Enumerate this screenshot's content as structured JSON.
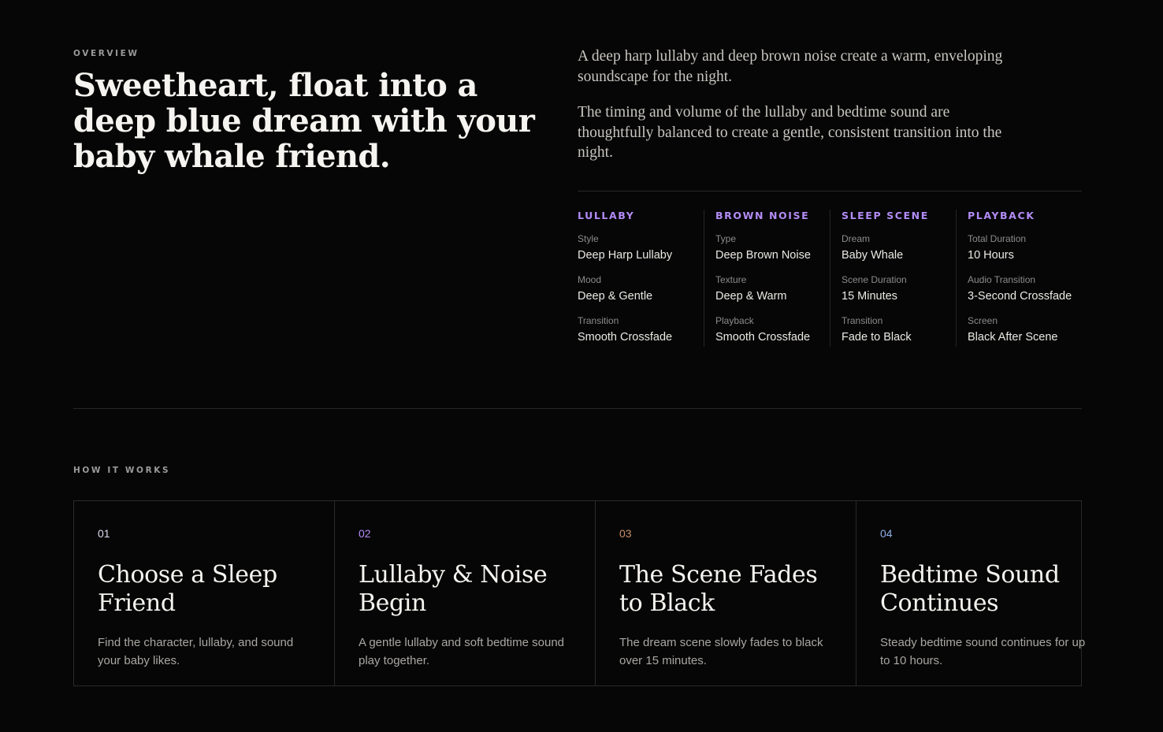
{
  "overview": {
    "eyebrow": "OVERVIEW",
    "title": "Sweetheart, float into a deep blue dream with your baby whale friend.",
    "paragraphs": [
      "A deep harp lullaby and deep brown noise create a warm, enveloping soundscape for the night.",
      "The timing and volume of the lullaby and bedtime sound are thoughtfully balanced to create a gentle, consistent transition into the night."
    ]
  },
  "specs": [
    {
      "heading": "LULLABY",
      "items": [
        {
          "key": "Style",
          "value": "Deep Harp Lullaby"
        },
        {
          "key": "Mood",
          "value": "Deep & Gentle"
        },
        {
          "key": "Transition",
          "value": "Smooth Crossfade"
        }
      ]
    },
    {
      "heading": "BROWN NOISE",
      "items": [
        {
          "key": "Type",
          "value": "Deep Brown Noise"
        },
        {
          "key": "Texture",
          "value": "Deep & Warm"
        },
        {
          "key": "Playback",
          "value": "Smooth Crossfade"
        }
      ]
    },
    {
      "heading": "SLEEP SCENE",
      "items": [
        {
          "key": "Dream",
          "value": "Baby Whale"
        },
        {
          "key": "Scene Duration",
          "value": "15 Minutes"
        },
        {
          "key": "Transition",
          "value": "Fade to Black"
        }
      ]
    },
    {
      "heading": "PLAYBACK",
      "items": [
        {
          "key": "Total Duration",
          "value": "10 Hours"
        },
        {
          "key": "Audio Transition",
          "value": "3-Second Crossfade"
        },
        {
          "key": "Screen",
          "value": "Black After Scene"
        }
      ]
    }
  ],
  "how_it_works": {
    "eyebrow": "HOW IT WORKS",
    "steps": [
      {
        "num": "01",
        "num_color": "#dcdcf0",
        "title": "Choose a Sleep Friend",
        "desc": "Find the character, lullaby, and sound your baby likes."
      },
      {
        "num": "02",
        "num_color": "#b38cf5",
        "title": "Lullaby & Noise Begin",
        "desc": "A gentle lullaby and soft bedtime sound play together."
      },
      {
        "num": "03",
        "num_color": "#c98f6a",
        "title": "The Scene Fades to Black",
        "desc": "The dream scene slowly fades to black over 15 minutes."
      },
      {
        "num": "04",
        "num_color": "#8fb0e8",
        "title": "Bedtime Sound Continues",
        "desc": "Steady bedtime sound continues for up to 10 hours."
      }
    ]
  },
  "colors": {
    "background": "#060606",
    "accent": "#b38cf5"
  }
}
